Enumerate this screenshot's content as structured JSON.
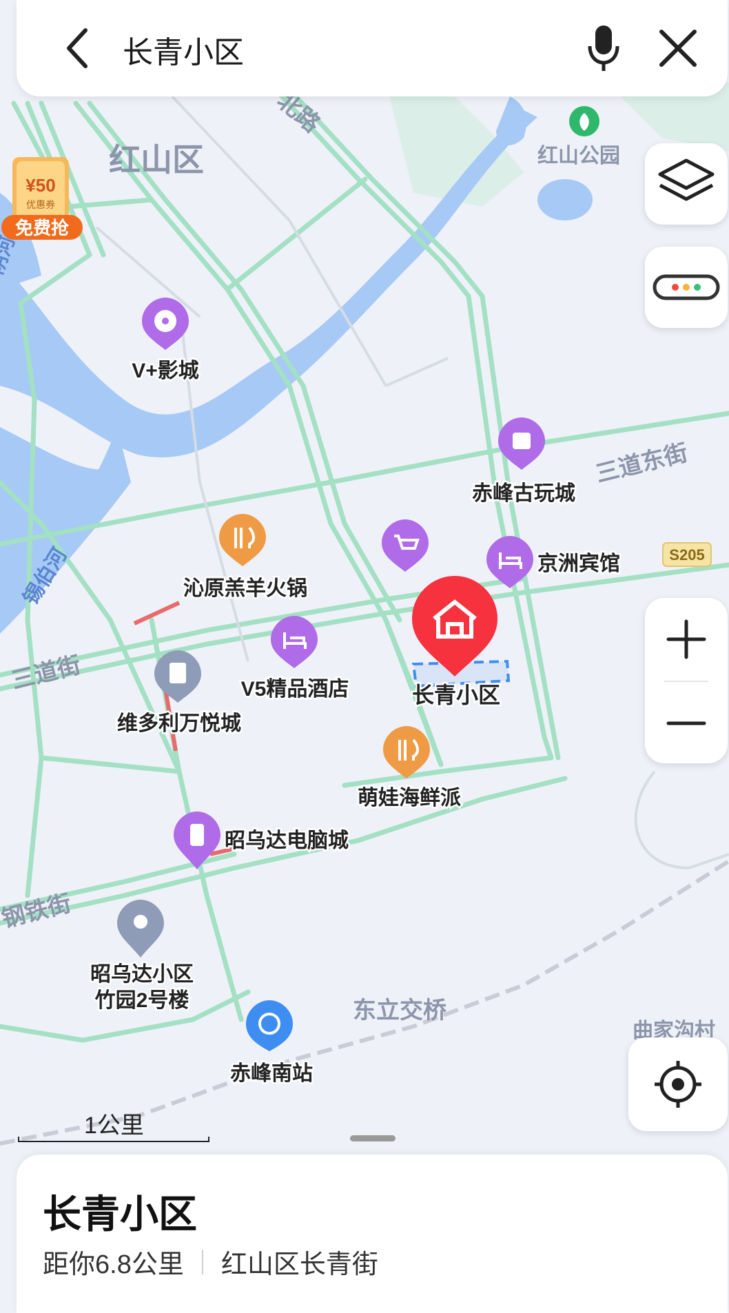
{
  "search": {
    "query": "长青小区"
  },
  "icons": {
    "back": "chevron-left-icon",
    "voice": "microphone-icon",
    "close": "close-icon",
    "layers": "layers-icon",
    "traffic": "traffic-lights-icon",
    "zoom_in": "plus-icon",
    "zoom_out": "minus-icon",
    "locate": "crosshair-icon"
  },
  "promo": {
    "amount": "¥50",
    "small": "优惠券",
    "cta": "免费抢"
  },
  "map_labels": {
    "district": "红山区",
    "road_north": "北路",
    "park": "红山公园",
    "river_xibo": "锡伯河",
    "river_left": "阴河",
    "sandao_east": "三道东街",
    "sandao": "三道街",
    "gangtie": "钢铁街",
    "dongli": "东立交桥",
    "qujia": "曲家沟村",
    "route": "S205"
  },
  "pois": {
    "cinema": "V+影城",
    "antique": "赤峰古玩城",
    "hotpot": "沁原羔羊火锅",
    "jingzhou": "京洲宾馆",
    "v5": "V5精品酒店",
    "selected": "长青小区",
    "victoria": "维多利万悦城",
    "mengwa": "萌娃海鲜派",
    "computer": "昭乌达电脑城",
    "zhaowuda_line1": "昭乌达小区",
    "zhaowuda_line2": "竹园2号楼",
    "station": "赤峰南站"
  },
  "scale": "1公里",
  "place_card": {
    "title": "长青小区",
    "distance": "距你6.8公里",
    "address": "红山区长青街"
  },
  "colors": {
    "map_bg": "#eef1f8",
    "road": "#a3e0c4",
    "river": "#a6c9f6",
    "poi_purple": "#b06ce8",
    "poi_orange": "#ef9b45",
    "poi_gray": "#8f9cb8",
    "poi_blue": "#3e8ef2",
    "selected_red": "#f5323e"
  }
}
